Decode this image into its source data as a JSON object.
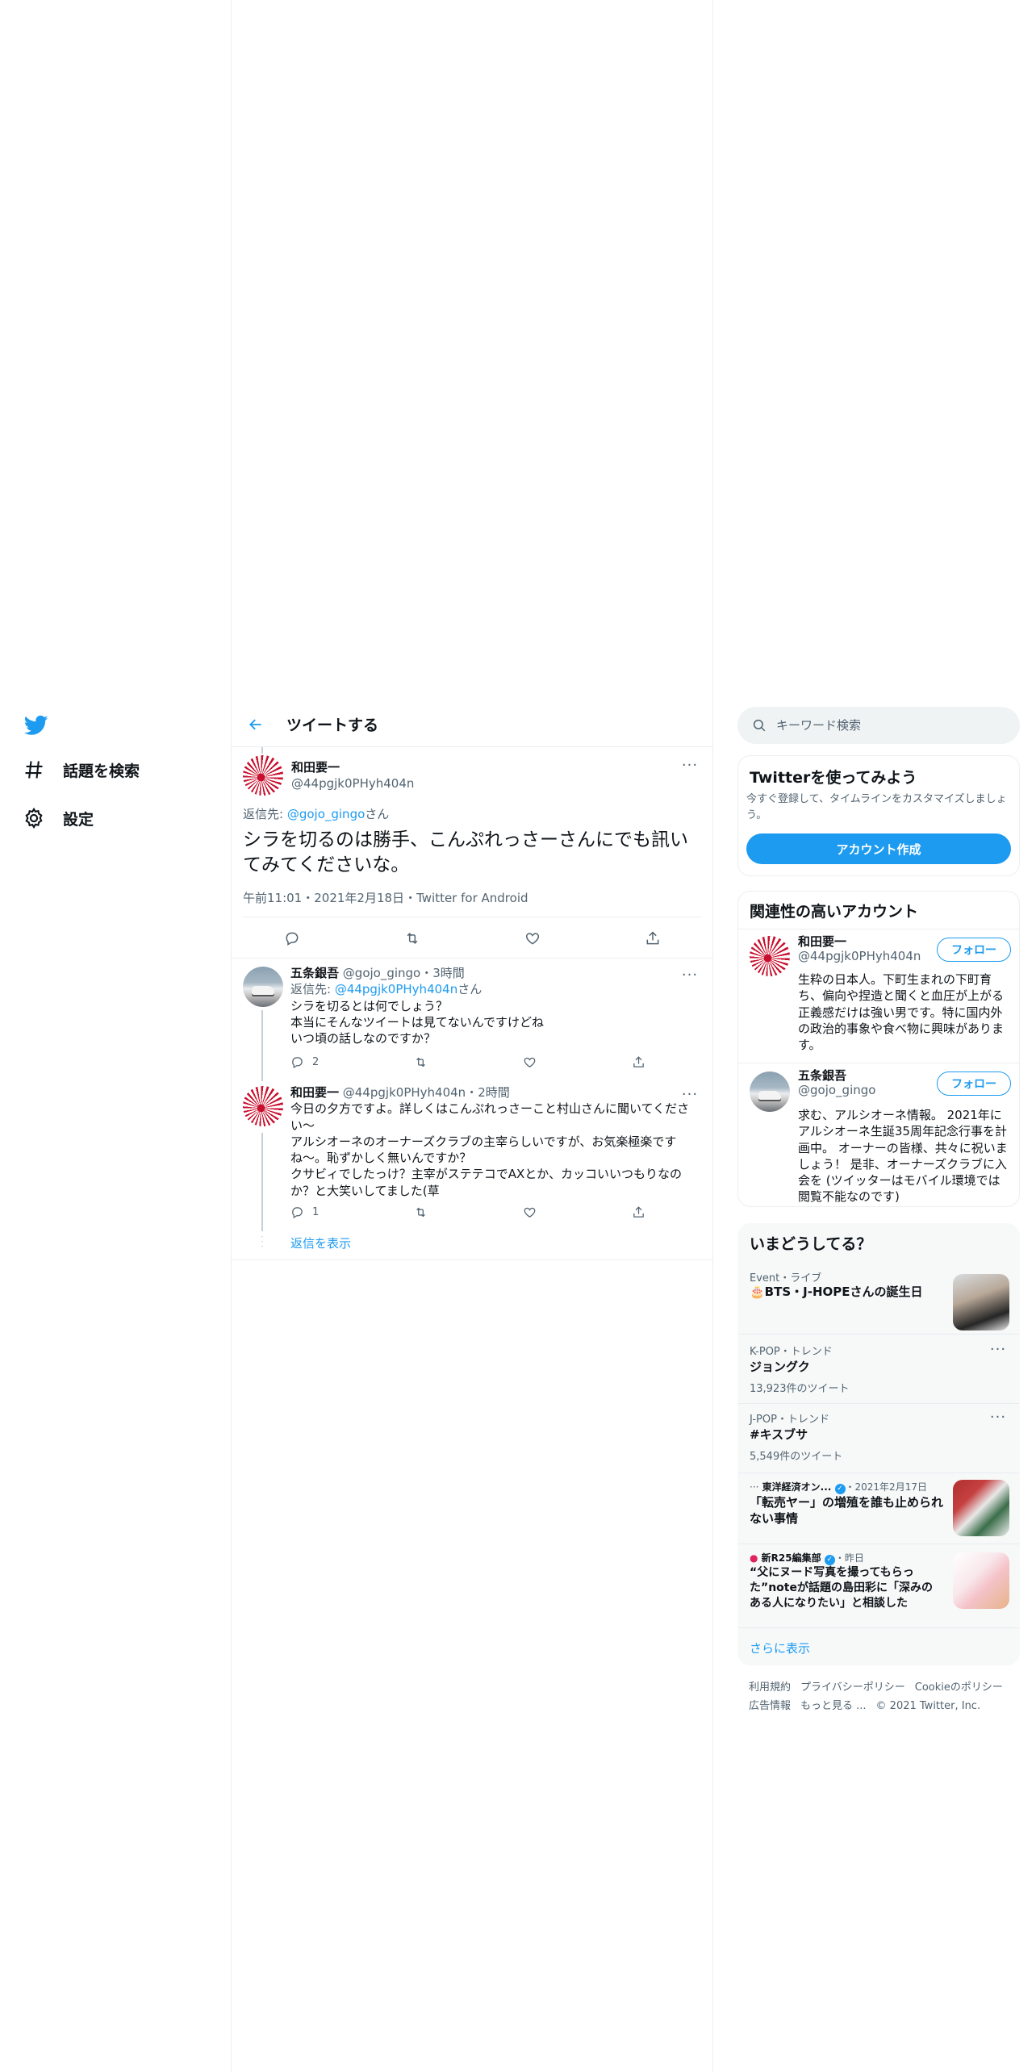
{
  "nav": {
    "items": [
      {
        "label": "話題を検索",
        "icon": "hashtag-icon"
      },
      {
        "label": "設定",
        "icon": "gear-icon"
      }
    ]
  },
  "header": {
    "title": "ツイートする"
  },
  "main_tweet": {
    "name": "和田要一",
    "handle": "@44pgjk0PHyh404n",
    "reply_prefix": "返信先: ",
    "reply_handle": "@gojo_gingo",
    "reply_suffix": "さん",
    "text": "シラを切るのは勝手、こんぷれっさーさんにでも訊いてみてくださいな。",
    "time": "午前11:01",
    "date": "2021年2月18日",
    "source": "Twitter for Android",
    "sep": "・"
  },
  "replies": [
    {
      "name": "五条銀吾",
      "handle": "@gojo_gingo",
      "time": "3時間",
      "reply_prefix": "返信先: ",
      "reply_handle": "@44pgjk0PHyh404n",
      "reply_suffix": "さん",
      "lines": [
        "シラを切るとは何でしょう？",
        "本当にそんなツイートは見てないんですけどね",
        "いつ頃の話しなのですか？"
      ],
      "reply_count": "2"
    },
    {
      "name": "和田要一",
      "handle": "@44pgjk0PHyh404n",
      "time": "2時間",
      "lines": [
        "今日の夕方ですよ。詳しくはこんぷれっさーこと村山さんに聞いてください〜",
        "アルシオーネのオーナーズクラブの主宰らしいですが、お気楽極楽ですね〜。恥ずかしく無いんですか？",
        "クサビィでしたっけ？主宰がステテコでAXとか、カッコいいつもりなのか？と大笑いしてました(草"
      ],
      "reply_count": "1"
    }
  ],
  "show_replies": "返信を表示",
  "search": {
    "placeholder": "キーワード検索"
  },
  "signup": {
    "title": "Twitterを使ってみよう",
    "desc": "今すぐ登録して、タイムラインをカスタマイズしましょう。",
    "button": "アカウント作成"
  },
  "relevant": {
    "title": "関連性の高いアカウント",
    "follow_label": "フォロー",
    "accounts": [
      {
        "name": "和田要一",
        "handle": "@44pgjk0PHyh404n",
        "bio": "生粋の日本人。下町生まれの下町育ち、偏向や捏造と聞くと血圧が上がる正義感だけは強い男です。特に国内外の政治的事象や食べ物に興味があります。"
      },
      {
        "name": "五条銀吾",
        "handle": "@gojo_gingo",
        "bio": "求む、アルシオーネ情報。 2021年にアルシオーネ生誕35周年記念行事を計画中。 オーナーの皆様、共々に祝いましょう！ 是非、オーナーズクラブに入会を (ツイッターはモバイル環境では閲覧不能なのです)"
      }
    ]
  },
  "trends": {
    "title": "いまどうしてる？",
    "items": [
      {
        "meta": "Event・ライブ",
        "title": "🎂BTS・J-HOPEさんの誕生日"
      },
      {
        "meta": "K-POP・トレンド",
        "title": "ジョングク",
        "count": "13,923件のツイート"
      },
      {
        "meta": "J-POP・トレンド",
        "title": "#キスブサ",
        "count": "5,549件のツイート"
      },
      {
        "meta": "東洋経済オン...",
        "date": "・2021年2月17日",
        "title": "「転売ヤー」の増殖を誰も止められない事情"
      },
      {
        "meta": "新R25編集部",
        "date": "・昨日",
        "title": "“父にヌード写真を撮ってもらった”noteが話題の島田彩に「深みのある人になりたい」と相談した"
      }
    ],
    "more": "さらに表示"
  },
  "footer": {
    "links": [
      "利用規約",
      "プライバシーポリシー",
      "Cookieのポリシー",
      "広告情報",
      "もっと見る ...",
      "© 2021 Twitter, Inc."
    ]
  },
  "colors": {
    "accent": "#1d9bf0",
    "text": "#0f1419",
    "muted": "#536471",
    "border": "#ebeef0"
  }
}
